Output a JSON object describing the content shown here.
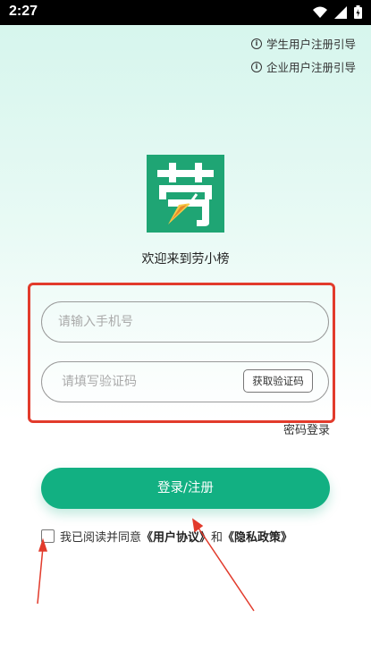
{
  "status_bar": {
    "time": "2:27"
  },
  "guides": [
    {
      "label": "学生用户注册引导"
    },
    {
      "label": "企业用户注册引导"
    }
  ],
  "logo": {
    "char": "劳"
  },
  "welcome": "欢迎来到劳小榜",
  "form": {
    "phone_placeholder": "请输入手机号",
    "code_placeholder": "请填写验证码",
    "get_code_label": "获取验证码",
    "password_login_label": "密码登录",
    "submit_label": "登录/注册"
  },
  "agreement": {
    "prefix": "我已阅读并同意",
    "user_agreement": "《用户协议》",
    "and": "和",
    "privacy_policy": "《隐私政策》"
  },
  "colors": {
    "brand": "#12b082",
    "annotation": "#e23b2c"
  }
}
